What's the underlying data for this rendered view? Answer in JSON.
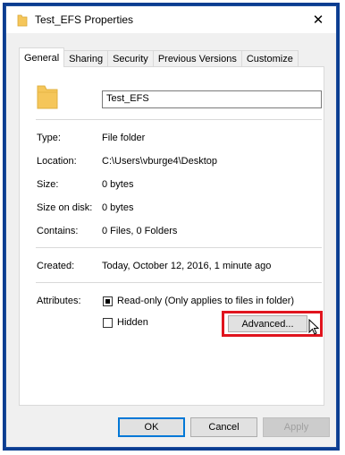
{
  "window": {
    "title": "Test_EFS Properties",
    "close_symbol": "✕"
  },
  "tabs": [
    {
      "label": "General",
      "active": true
    },
    {
      "label": "Sharing",
      "active": false
    },
    {
      "label": "Security",
      "active": false
    },
    {
      "label": "Previous Versions",
      "active": false
    },
    {
      "label": "Customize",
      "active": false
    }
  ],
  "general": {
    "folder_name": "Test_EFS",
    "type_label": "Type:",
    "type_value": "File folder",
    "location_label": "Location:",
    "location_value": "C:\\Users\\vburge4\\Desktop",
    "size_label": "Size:",
    "size_value": "0 bytes",
    "size_on_disk_label": "Size on disk:",
    "size_on_disk_value": "0 bytes",
    "contains_label": "Contains:",
    "contains_value": "0 Files, 0 Folders",
    "created_label": "Created:",
    "created_value": "Today, October 12, 2016, 1 minute ago",
    "attributes_label": "Attributes:",
    "readonly_label": "Read-only (Only applies to files in folder)",
    "readonly_state": "indeterminate",
    "hidden_label": "Hidden",
    "hidden_checked": false,
    "advanced_label": "Advanced..."
  },
  "buttons": {
    "ok": "OK",
    "cancel": "Cancel",
    "apply": "Apply"
  },
  "icons": {
    "title": "folder-icon",
    "folder_big": "folder-icon",
    "cursor": "mouse-pointer-icon"
  },
  "colors": {
    "highlight": "#e0141e",
    "folder": "#f5c65a",
    "window_border": "#0a3d91",
    "default_button_border": "#0078d7"
  }
}
